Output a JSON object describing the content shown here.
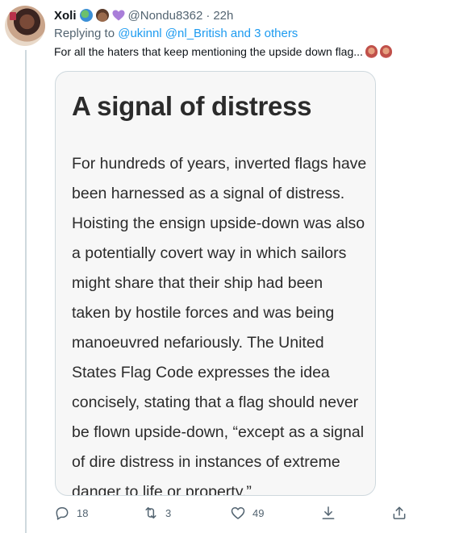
{
  "tweet": {
    "name": "Xoli",
    "handle": "@Nondu8362",
    "separator": "·",
    "time": "22h",
    "replying_prefix": "Replying to ",
    "replying_mentions": "@ukinnl @nl_British",
    "replying_connector": " and ",
    "replying_others": "3 others",
    "text": "For all the haters that keep mentioning the upside down flag..."
  },
  "card": {
    "title": "A signal of distress",
    "lines": [
      "For hundreds of years, inverted flags have",
      "been harnessed as a signal of distress.",
      "Hoisting the ensign upside-down was also",
      "a potentially covert way in which sailors",
      "might share that their ship had been",
      "taken by hostile forces and was being",
      "manoeuvred nefariously. The United",
      "States Flag Code expresses the idea",
      "concisely, stating that a flag should never",
      "be flown upside-down, “except as a signal",
      "of dire distress in instances of extreme",
      "danger to life or property.”"
    ]
  },
  "actions": {
    "reply_count": "18",
    "retweet_count": "3",
    "like_count": "49"
  },
  "icons": {
    "reply": "speech-bubble-icon",
    "retweet": "retweet-arrows-icon",
    "like": "heart-outline-icon",
    "download": "download-arrow-icon",
    "share": "share-upload-icon"
  },
  "colors": {
    "link": "#1d9bf0",
    "secondary": "#536471",
    "text": "#0f1419",
    "border": "#cfd9de"
  }
}
